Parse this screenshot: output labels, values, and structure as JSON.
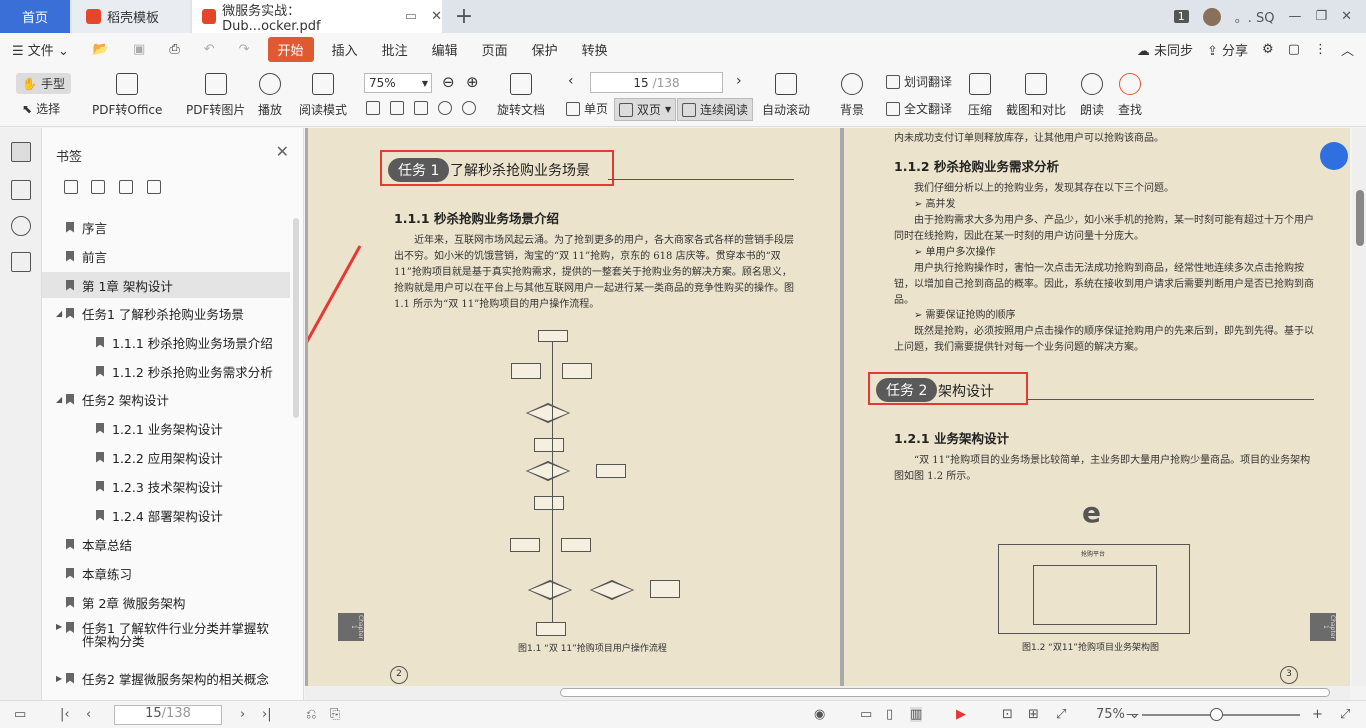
{
  "tabs": {
    "home": "首页",
    "daoke": "稻壳模板",
    "pdf": "微服务实战：Dub...ocker.pdf",
    "badge": "1",
    "user": "。. SQ"
  },
  "menu": {
    "file": "文件",
    "items": [
      "开始",
      "插入",
      "批注",
      "编辑",
      "页面",
      "保护",
      "转换"
    ],
    "sync": "未同步",
    "share": "分享"
  },
  "toolbar": {
    "hand": "手型",
    "select": "选择",
    "pdf_office": "PDF转Office",
    "pdf_image": "PDF转图片",
    "play": "播放",
    "read_mode": "阅读模式",
    "zoom": "75%",
    "rotate": "旋转文档",
    "page_current": "15",
    "page_total": "/138",
    "single": "单页",
    "double": "双页",
    "continuous": "连续阅读",
    "autoscroll": "自动滚动",
    "background": "背景",
    "word_translate": "划词翻译",
    "full_translate": "全文翻译",
    "compress": "压缩",
    "screenshot": "截图和对比",
    "read_aloud": "朗读",
    "find": "查找"
  },
  "bookmarks": {
    "title": "书签",
    "items": [
      {
        "label": "序言",
        "level": 0,
        "arrow": ""
      },
      {
        "label": "前言",
        "level": 0,
        "arrow": ""
      },
      {
        "label": "第 1章  架构设计",
        "level": 0,
        "arrow": "",
        "selected": true
      },
      {
        "label": "任务1  了解秒杀抢购业务场景",
        "level": 0,
        "arrow": "◢"
      },
      {
        "label": "1.1.1  秒杀抢购业务场景介绍",
        "level": 1,
        "arrow": ""
      },
      {
        "label": "1.1.2  秒杀抢购业务需求分析",
        "level": 1,
        "arrow": ""
      },
      {
        "label": "任务2  架构设计",
        "level": 0,
        "arrow": "◢"
      },
      {
        "label": "1.2.1  业务架构设计",
        "level": 1,
        "arrow": ""
      },
      {
        "label": "1.2.2  应用架构设计",
        "level": 1,
        "arrow": ""
      },
      {
        "label": "1.2.3  技术架构设计",
        "level": 1,
        "arrow": ""
      },
      {
        "label": "1.2.4  部署架构设计",
        "level": 1,
        "arrow": ""
      },
      {
        "label": "本章总结",
        "level": 0,
        "arrow": ""
      },
      {
        "label": "本章练习",
        "level": 0,
        "arrow": ""
      },
      {
        "label": "第 2章  微服务架构",
        "level": 0,
        "arrow": ""
      },
      {
        "label": "任务1  了解软件行业分类并掌握软件架构分类",
        "level": 0,
        "arrow": "▶"
      },
      {
        "label": "任务2  掌握微服务架构的相关概念",
        "level": 0,
        "arrow": "▶"
      }
    ]
  },
  "left_page": {
    "task_tag": "任务 1",
    "task_title": "了解秒杀抢购业务场景",
    "section": "1.1.1   秒杀抢购业务场景介绍",
    "para": "近年来，互联网市场风起云涌。为了抢到更多的用户，各大商家各式各样的营销手段层出不穷。如小米的饥饿营销，淘宝的“双 11”抢购，京东的 618 店庆等。贯穿本书的“双 11”抢购项目就是基于真实抢购需求，提供的一整套关于抢购业务的解决方案。顾名思义，抢购就是用户可以在平台上与其他互联网用户一起进行某一类商品的竞争性购买的操作。图 1.1 所示为“双 11”抢购项目的用户操作流程。",
    "caption": "图1.1  “双 11”抢购项目用户操作流程",
    "page_no": "2",
    "chapter": "Chapter 1"
  },
  "right_page": {
    "top_line": "内未成功支付订单则释放库存，让其他用户可以抢购该商品。",
    "section": "1.1.2   秒杀抢购业务需求分析",
    "intro": "我们仔细分析以上的抢购业务，发现其存在以下三个问题。",
    "b1": "➢   高并发",
    "b1_text": "由于抢购需求大多为用户多、产品少，如小米手机的抢购，某一时刻可能有超过十万个用户同时在线抢购，因此在某一时刻的用户访问量十分庞大。",
    "b2": "➢   单用户多次操作",
    "b2_text": "用户执行抢购操作时，害怕一次点击无法成功抢购到商品，经常性地连续多次点击抢购按钮，以增加自己抢到商品的概率。因此，系统在接收到用户请求后需要判断用户是否已抢购到商品。",
    "b3": "➢   需要保证抢购的顺序",
    "b3_text": "既然是抢购，必须按照用户点击操作的顺序保证抢购用户的先来后到，即先到先得。基于以上问题，我们需要提供针对每一个业务问题的解决方案。",
    "task_tag": "任务 2",
    "task_title": "架构设计",
    "section2": "1.2.1   业务架构设计",
    "para2": "“双 11”抢购项目的业务场景比较简单，主业务即大量用户抢购少量商品。项目的业务架构图如图 1.2 所示。",
    "platform": "抢购平台",
    "caption": "图1.2  “双11”抢购项目业务架构图",
    "page_no": "3",
    "chapter": "Chapter 1"
  },
  "status": {
    "page_current": "15",
    "page_total": "/138",
    "zoom": "75%"
  },
  "colors": {
    "accent": "#3b6fd8",
    "start": "#e05a31",
    "highlight": "#e53935"
  }
}
